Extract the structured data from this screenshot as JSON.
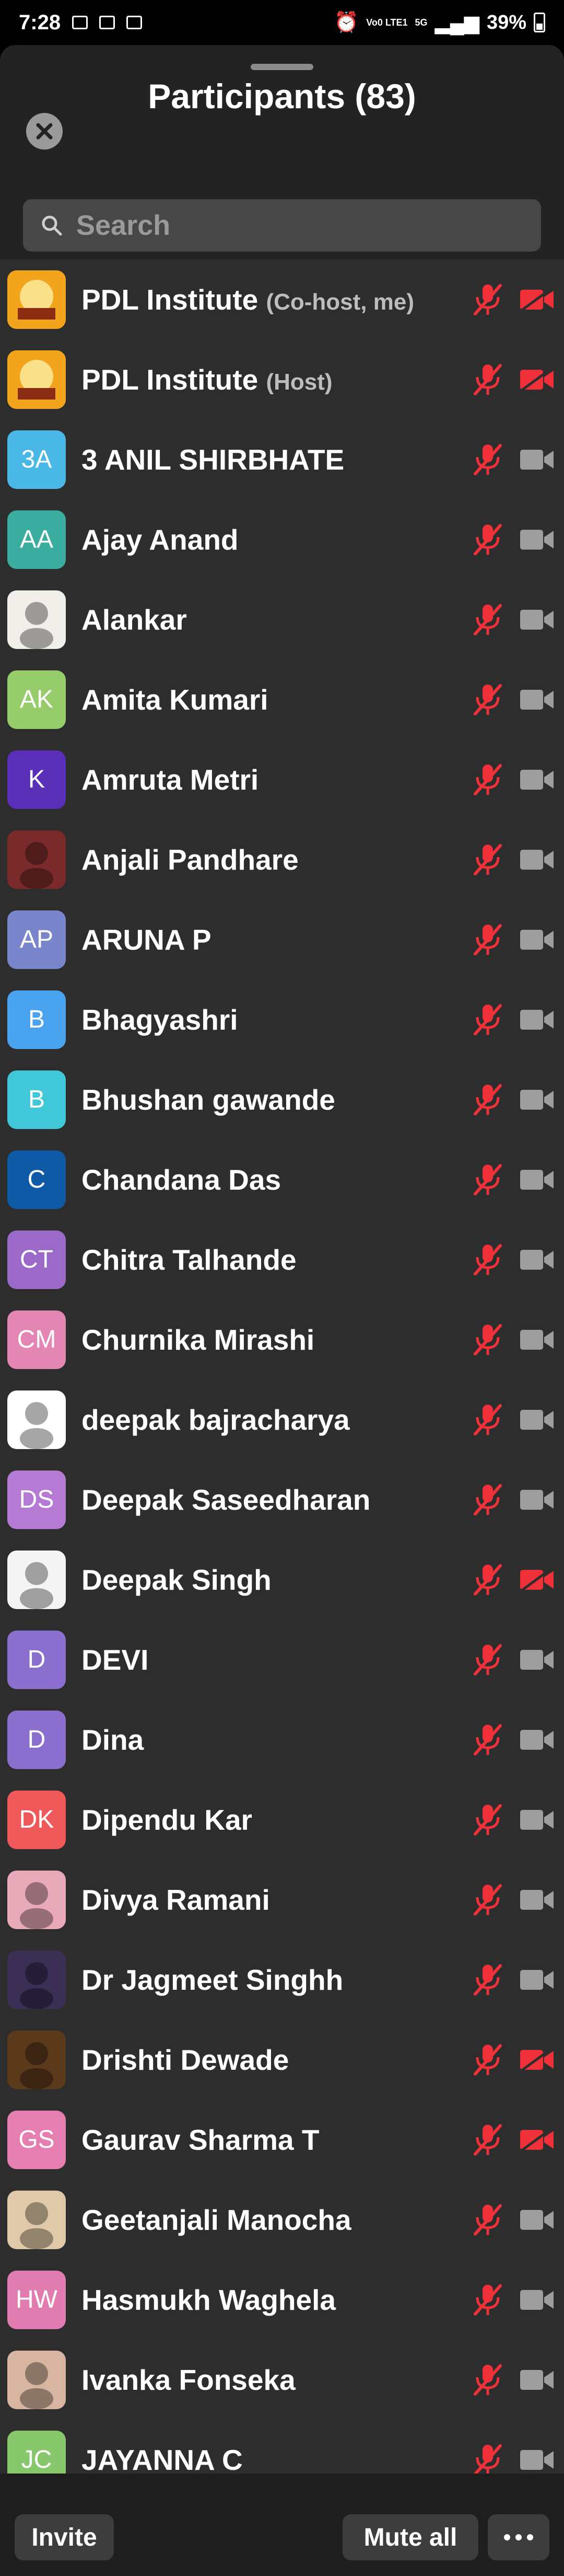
{
  "status_bar": {
    "time": "7:28",
    "battery": "39%",
    "network": "Vo0 LTE1",
    "signal_label": "5G"
  },
  "header": {
    "title": "Participants (83)"
  },
  "search": {
    "placeholder": "Search"
  },
  "participants": [
    {
      "name": "PDL Institute",
      "role": "(Co-host, me)",
      "avatar_text": "",
      "avatar_color": "#e0a020",
      "avatar_kind": "logo",
      "video_off_red": true
    },
    {
      "name": "PDL Institute",
      "role": "(Host)",
      "avatar_text": "",
      "avatar_color": "#e0a020",
      "avatar_kind": "logo",
      "video_off_red": true
    },
    {
      "name": "3 ANIL SHIRBHATE",
      "role": "",
      "avatar_text": "3A",
      "avatar_color": "#49b8e7",
      "avatar_kind": "initials",
      "video_off_red": false
    },
    {
      "name": "Ajay Anand",
      "role": "",
      "avatar_text": "AA",
      "avatar_color": "#3aada0",
      "avatar_kind": "initials",
      "video_off_red": false
    },
    {
      "name": "Alankar",
      "role": "",
      "avatar_text": "",
      "avatar_color": "#f1efe9",
      "avatar_kind": "photo",
      "video_off_red": false
    },
    {
      "name": "Amita Kumari",
      "role": "",
      "avatar_text": "AK",
      "avatar_color": "#96cd6a",
      "avatar_kind": "initials",
      "video_off_red": false
    },
    {
      "name": "Amruta Metri",
      "role": "",
      "avatar_text": "K",
      "avatar_color": "#5a2fb8",
      "avatar_kind": "initials",
      "video_off_red": false
    },
    {
      "name": "Anjali Pandhare",
      "role": "",
      "avatar_text": "",
      "avatar_color": "#7a2a2a",
      "avatar_kind": "photo",
      "video_off_red": false
    },
    {
      "name": "ARUNA P",
      "role": "",
      "avatar_text": "AP",
      "avatar_color": "#7986cb",
      "avatar_kind": "initials",
      "video_off_red": false
    },
    {
      "name": "Bhagyashri",
      "role": "",
      "avatar_text": "B",
      "avatar_color": "#4aa3ee",
      "avatar_kind": "initials",
      "video_off_red": false
    },
    {
      "name": "Bhushan  gawande",
      "role": "",
      "avatar_text": "B",
      "avatar_color": "#40c8d8",
      "avatar_kind": "initials",
      "video_off_red": false
    },
    {
      "name": "Chandana Das",
      "role": "",
      "avatar_text": "C",
      "avatar_color": "#0e5aa7",
      "avatar_kind": "initials",
      "video_off_red": false
    },
    {
      "name": "Chitra Talhande",
      "role": "",
      "avatar_text": "CT",
      "avatar_color": "#9b6ac9",
      "avatar_kind": "initials",
      "video_off_red": false
    },
    {
      "name": "Churnika Mirashi",
      "role": "",
      "avatar_text": "CM",
      "avatar_color": "#e486b4",
      "avatar_kind": "initials",
      "video_off_red": false
    },
    {
      "name": "deepak bajracharya",
      "role": "",
      "avatar_text": "",
      "avatar_color": "#ffffff",
      "avatar_kind": "photo",
      "video_off_red": false
    },
    {
      "name": "Deepak Saseedharan",
      "role": "",
      "avatar_text": "DS",
      "avatar_color": "#b57bd4",
      "avatar_kind": "initials",
      "video_off_red": false
    },
    {
      "name": "Deepak Singh",
      "role": "",
      "avatar_text": "",
      "avatar_color": "#f4f4f4",
      "avatar_kind": "photo",
      "video_off_red": true
    },
    {
      "name": "DEVI",
      "role": "",
      "avatar_text": "D",
      "avatar_color": "#8a6fcf",
      "avatar_kind": "initials",
      "video_off_red": false
    },
    {
      "name": "Dina",
      "role": "",
      "avatar_text": "D",
      "avatar_color": "#8a6fcf",
      "avatar_kind": "initials",
      "video_off_red": false
    },
    {
      "name": "Dipendu Kar",
      "role": "",
      "avatar_text": "DK",
      "avatar_color": "#f0595a",
      "avatar_kind": "initials",
      "video_off_red": false
    },
    {
      "name": "Divya Ramani",
      "role": "",
      "avatar_text": "",
      "avatar_color": "#e8a9b8",
      "avatar_kind": "photo",
      "video_off_red": false
    },
    {
      "name": "Dr Jagmeet Singhh",
      "role": "",
      "avatar_text": "",
      "avatar_color": "#3b2f55",
      "avatar_kind": "photo",
      "video_off_red": false
    },
    {
      "name": "Drishti Dewade",
      "role": "",
      "avatar_text": "",
      "avatar_color": "#5b3a1c",
      "avatar_kind": "photo",
      "video_off_red": true
    },
    {
      "name": "Gaurav Sharma T",
      "role": "",
      "avatar_text": "GS",
      "avatar_color": "#e57fb1",
      "avatar_kind": "initials",
      "video_off_red": true
    },
    {
      "name": "Geetanjali Manocha",
      "role": "",
      "avatar_text": "",
      "avatar_color": "#e0c9a8",
      "avatar_kind": "photo",
      "video_off_red": false
    },
    {
      "name": "Hasmukh Waghela",
      "role": "",
      "avatar_text": "HW",
      "avatar_color": "#e07cb0",
      "avatar_kind": "initials",
      "video_off_red": false
    },
    {
      "name": "Ivanka Fonseka",
      "role": "",
      "avatar_text": "",
      "avatar_color": "#d8b5a0",
      "avatar_kind": "photo",
      "video_off_red": false
    },
    {
      "name": "JAYANNA C",
      "role": "",
      "avatar_text": "JC",
      "avatar_color": "#88c86c",
      "avatar_kind": "initials",
      "video_off_red": false
    }
  ],
  "footer": {
    "invite_label": "Invite",
    "mute_all_label": "Mute all"
  },
  "colors": {
    "muted_red": "#f0313a",
    "cam_grey": "#9e9e9e",
    "sheet_bg": "#232323",
    "list_bg": "#2d2d2d"
  },
  "icons": {
    "mic": "microphone-muted-icon",
    "cam": "video-camera-icon",
    "close": "close-icon",
    "search": "search-icon",
    "more": "more-icon"
  }
}
